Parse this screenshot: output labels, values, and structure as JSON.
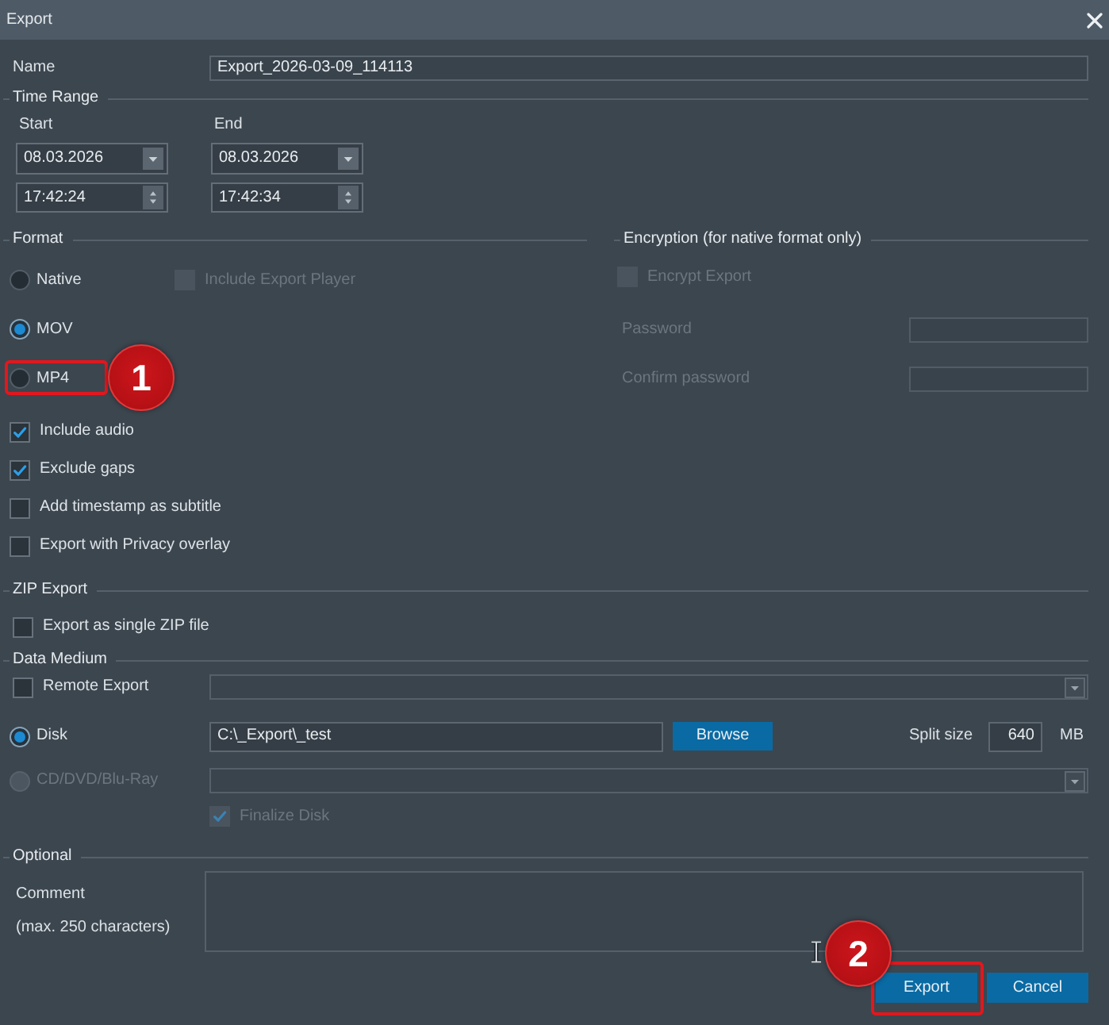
{
  "window": {
    "title": "Export"
  },
  "name_field": {
    "label": "Name",
    "value": "Export_2026-03-09_114113"
  },
  "time_range": {
    "title": "Time Range",
    "ends": [
      {
        "label": "Start",
        "date": "08.03.2026",
        "time": "17:42:24"
      },
      {
        "label": "End",
        "date": "08.03.2026",
        "time": "17:42:34"
      }
    ]
  },
  "format": {
    "title": "Format",
    "options": [
      {
        "label": "Native",
        "selected": false
      },
      {
        "label": "MOV",
        "selected": true
      },
      {
        "label": "MP4",
        "selected": false,
        "callout": "1"
      }
    ],
    "export_player": {
      "label": "Include Export Player",
      "checked": false,
      "disabled": true
    },
    "checkboxes": [
      {
        "label": "Include audio",
        "checked": true
      },
      {
        "label": "Exclude gaps",
        "checked": true
      },
      {
        "label": "Add timestamp as subtitle",
        "checked": false
      },
      {
        "label": "Export with Privacy overlay",
        "checked": false
      }
    ]
  },
  "encryption": {
    "title": "Encryption (for native format only)",
    "disabled": true,
    "encrypt": {
      "label": "Encrypt Export",
      "checked": false
    },
    "fields": [
      {
        "label": "Password"
      },
      {
        "label": "Confirm password"
      }
    ]
  },
  "zip_export": {
    "title": "ZIP Export",
    "single_zip": {
      "label": "Export as single ZIP file",
      "checked": false
    }
  },
  "data_medium": {
    "title": "Data Medium",
    "remote": {
      "label": "Remote Export",
      "checked": false
    },
    "media": [
      {
        "kind": "disk",
        "label": "Disk",
        "selected": true,
        "disabled": false,
        "path": "C:\\_Export\\_test",
        "browse": "Browse",
        "split_label": "Split size",
        "split_value": "640",
        "split_unit": "MB"
      },
      {
        "kind": "optical",
        "label": "CD/DVD/Blu-Ray",
        "selected": false,
        "disabled": true,
        "finalize": {
          "label": "Finalize Disk",
          "checked": true,
          "disabled": true
        }
      }
    ]
  },
  "optional": {
    "title": "Optional",
    "comment_label": "Comment",
    "comment_hint": "(max. 250 characters)"
  },
  "buttons": [
    {
      "label": "Export",
      "callout": "2"
    },
    {
      "label": "Cancel"
    }
  ]
}
